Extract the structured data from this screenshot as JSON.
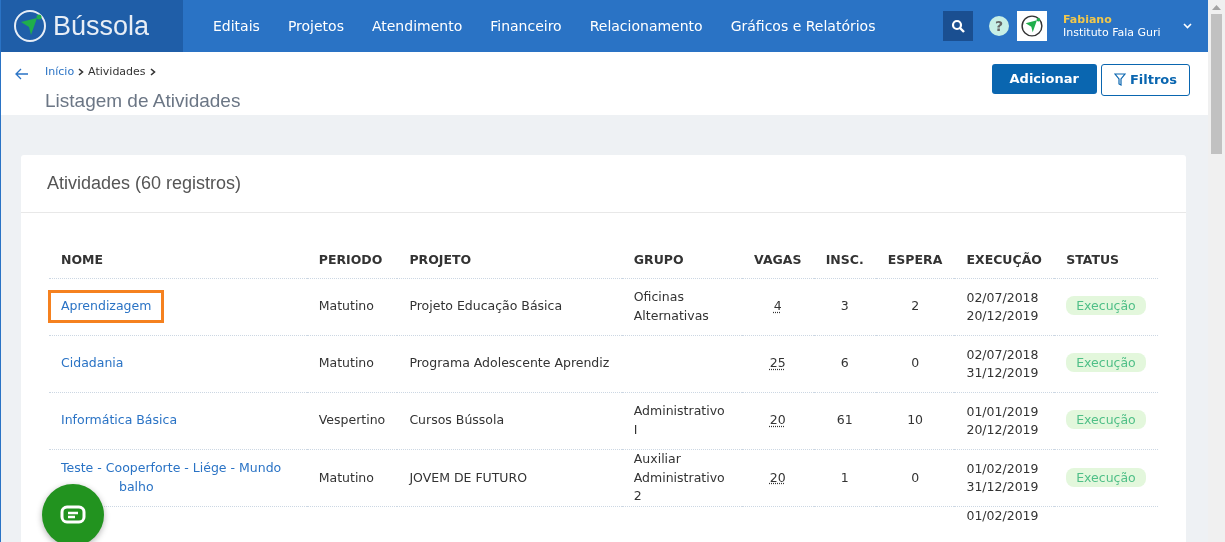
{
  "navbar": {
    "brand": "Bússola",
    "menu": [
      {
        "label": "Editais"
      },
      {
        "label": "Projetos"
      },
      {
        "label": "Atendimento"
      },
      {
        "label": "Financeiro"
      },
      {
        "label": "Relacionamento"
      },
      {
        "label": "Gráficos e Relatórios"
      }
    ],
    "help": "?",
    "user": {
      "name": "Fabiano",
      "org": "Instituto Fala Guri"
    }
  },
  "breadcrumb": [
    {
      "label": "Início",
      "link": true
    },
    {
      "label": "Atividades",
      "link": false
    }
  ],
  "page_title": "Listagem de Atividades",
  "actions": {
    "add": "Adicionar",
    "filter": "Filtros"
  },
  "card": {
    "title": "Atividades (60 registros)"
  },
  "table": {
    "columns": [
      "NOME",
      "PERIODO",
      "PROJETO",
      "GRUPO",
      "VAGAS",
      "INSC.",
      "ESPERA",
      "EXECUÇÃO",
      "STATUS"
    ],
    "rows": [
      {
        "nome": "Aprendizagem",
        "highlighted": true,
        "periodo": "Matutino",
        "projeto": "Projeto Educação Básica",
        "grupo": "Oficinas Alternativas",
        "vagas": "4",
        "insc": "3",
        "espera": "2",
        "execucao": [
          "02/07/2018",
          "20/12/2019"
        ],
        "status": "Execução"
      },
      {
        "nome": "Cidadania",
        "highlighted": false,
        "periodo": "Matutino",
        "projeto": "Programa Adolescente Aprendiz",
        "vagas": "25",
        "insc": "6",
        "espera": "0",
        "execucao": [
          "02/07/2018",
          "31/12/2019"
        ],
        "status": "Execução"
      },
      {
        "nome": "Informática Básica",
        "highlighted": false,
        "periodo": "Vespertino",
        "projeto": "Cursos Bússola",
        "grupo": "Administrativo I",
        "vagas": "20",
        "insc": "61",
        "espera": "10",
        "execucao": [
          "01/01/2019",
          "20/12/2019"
        ],
        "status": "Execução"
      },
      {
        "nome": "Teste - Cooperforte - Liége - Mundo",
        "nome_continued": "balho",
        "highlighted": false,
        "periodo": "Matutino",
        "projeto": "JOVEM DE FUTURO",
        "grupo": "Auxiliar Administrativo 2",
        "vagas": "20",
        "insc": "1",
        "espera": "0",
        "execucao": [
          "01/02/2019",
          "31/12/2019"
        ],
        "status": "Execução"
      },
      {
        "execucao": [
          "01/02/2019"
        ]
      }
    ]
  }
}
